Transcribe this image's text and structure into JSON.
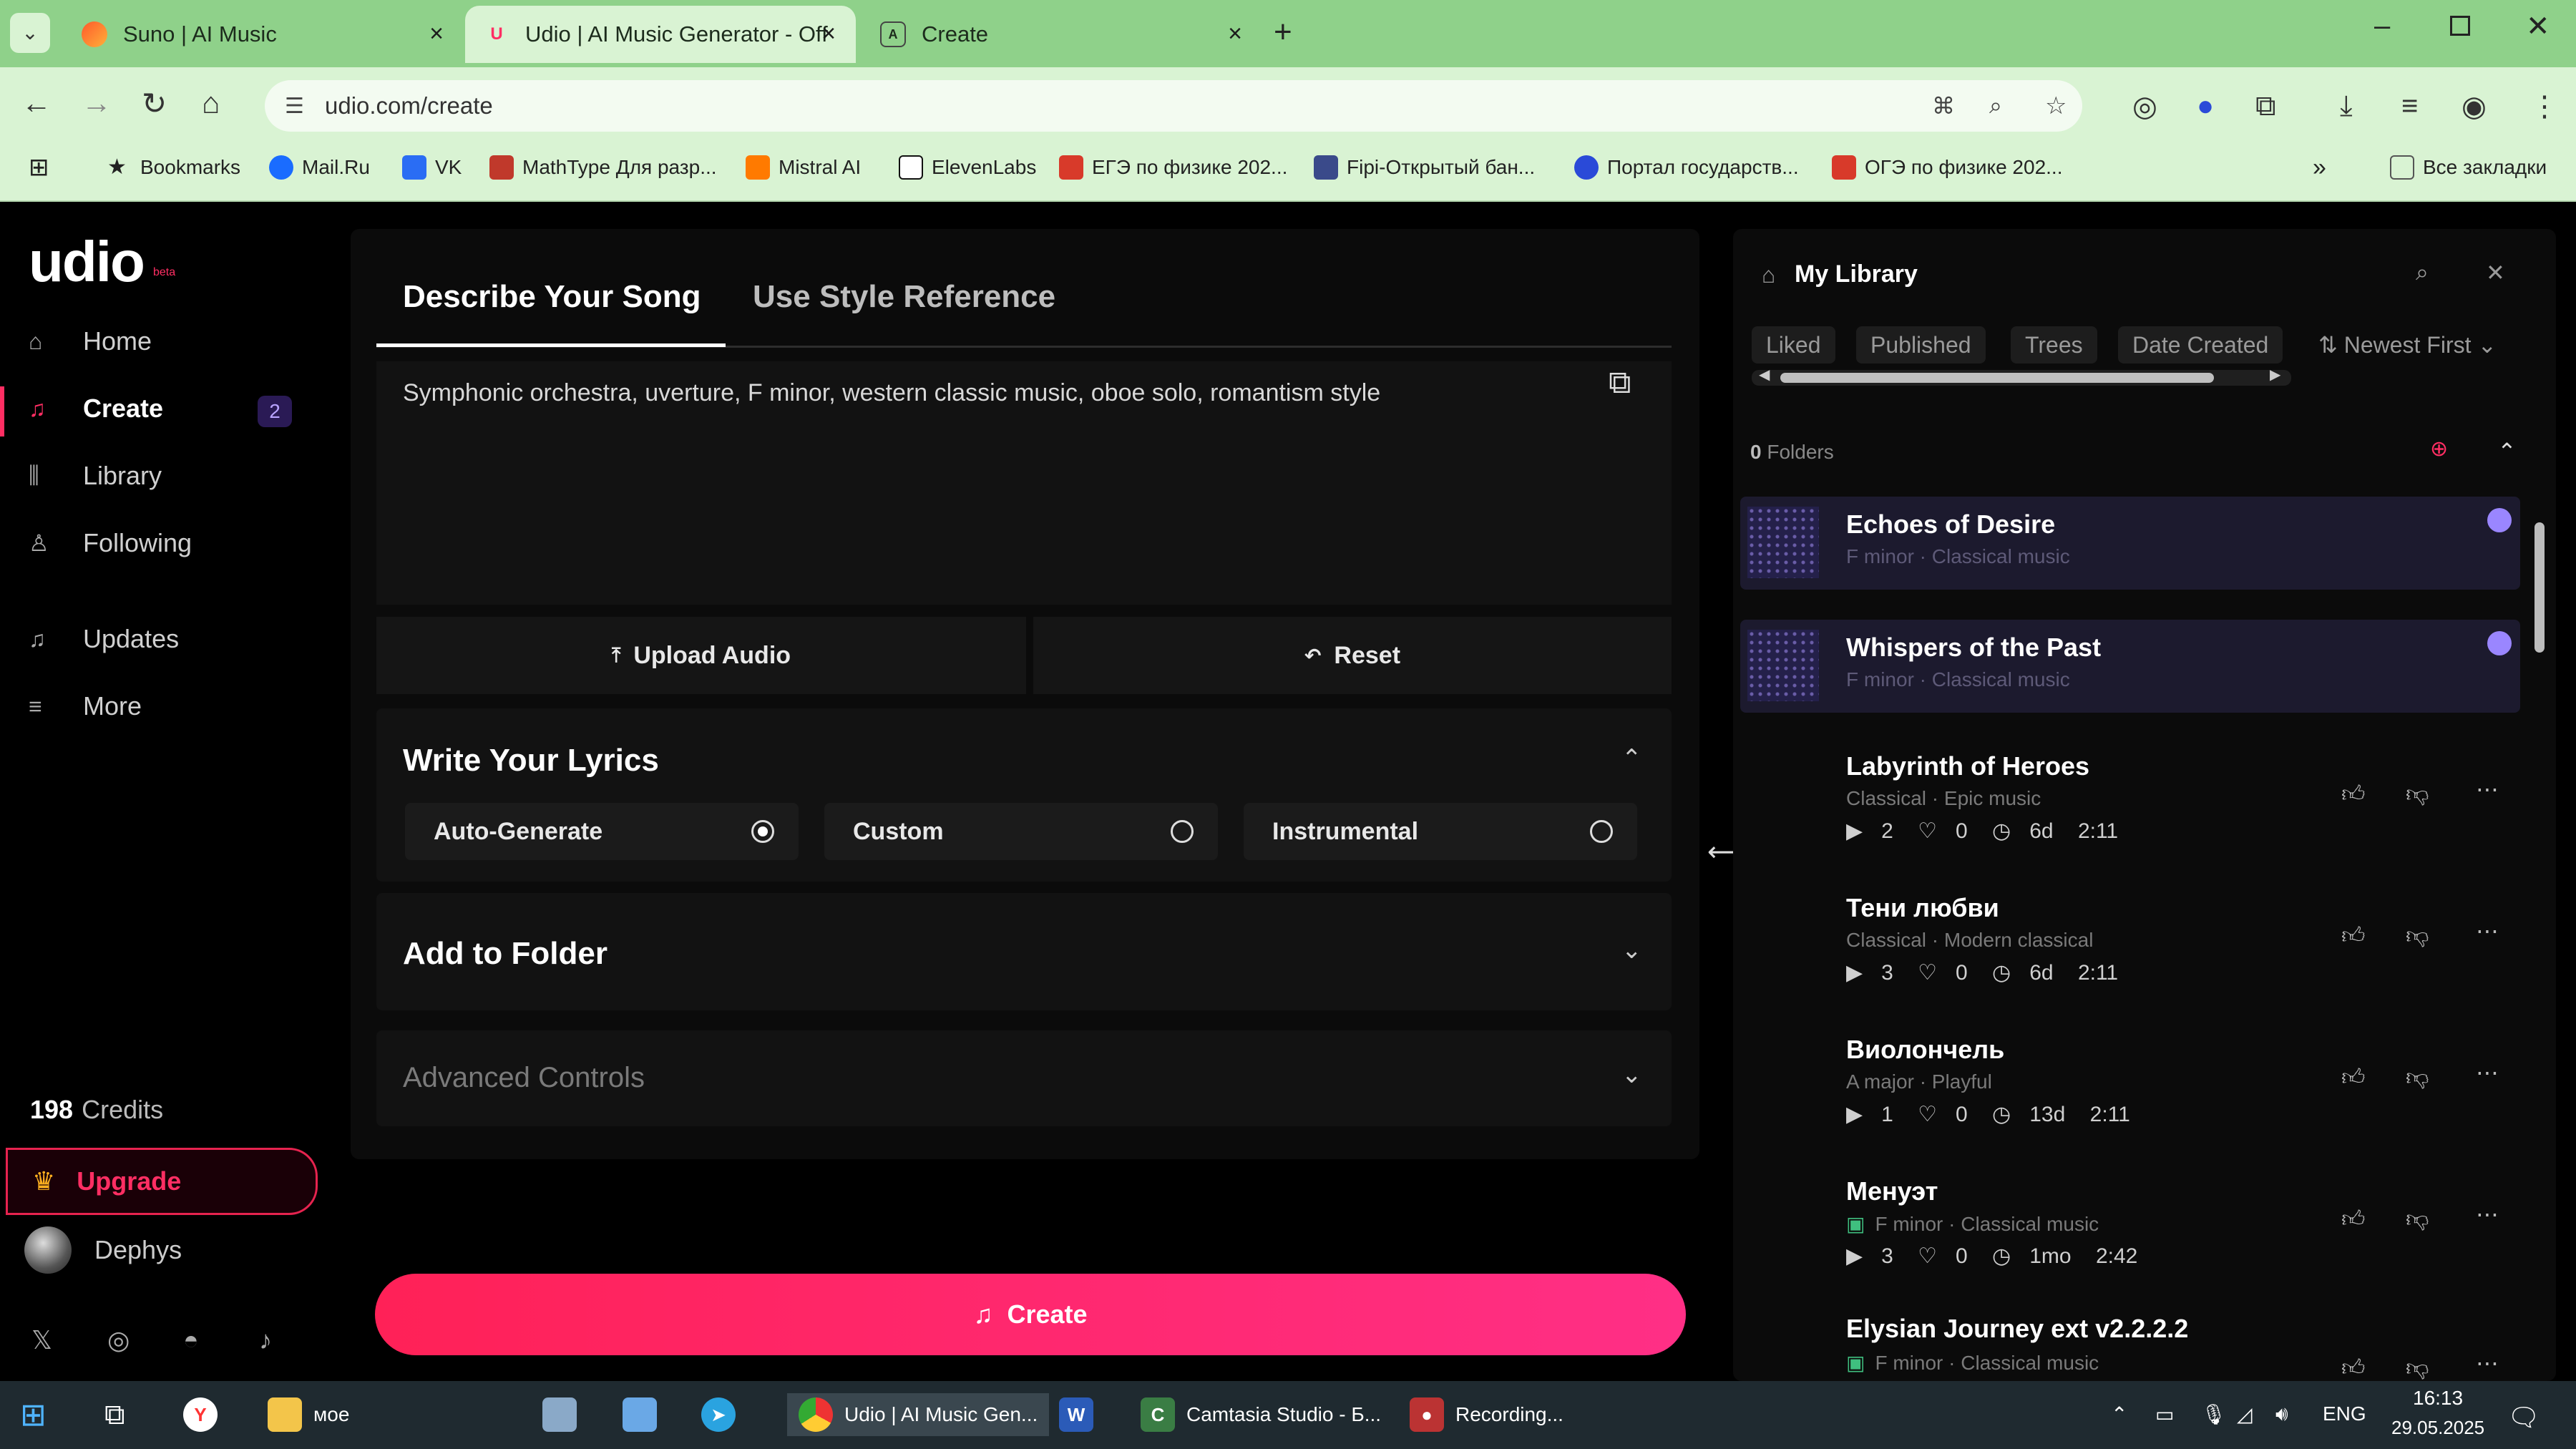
{
  "browser": {
    "tabs": [
      {
        "title": "Suno | AI Music",
        "icon": "suno-icon"
      },
      {
        "title": "Udio | AI Music Generator - Off",
        "icon": "udio-icon"
      },
      {
        "title": "Create",
        "icon": "page-icon"
      }
    ],
    "url": "udio.com/create",
    "bookmarks": [
      {
        "label": "Bookmarks",
        "color": "#222222"
      },
      {
        "label": "Mail.Ru",
        "color": "#1a6cff"
      },
      {
        "label": "VK",
        "color": "#2a6df4"
      },
      {
        "label": "MathType Для разр...",
        "color": "#c0392b"
      },
      {
        "label": "Mistral AI",
        "color": "#ff7a00"
      },
      {
        "label": "ElevenLabs",
        "color": "#111111"
      },
      {
        "label": "ЕГЭ по физике 202...",
        "color": "#d83a2a"
      },
      {
        "label": "Fipi-Открытый бан...",
        "color": "#3a4a8a"
      },
      {
        "label": "Портал государств...",
        "color": "#2a4ad8"
      },
      {
        "label": "ОГЭ по физике 202...",
        "color": "#d83a2a"
      }
    ],
    "all_bookmarks": "Все закладки"
  },
  "sidebar": {
    "logo": "udio",
    "nav": [
      {
        "label": "Home",
        "icon": "home-icon"
      },
      {
        "label": "Create",
        "icon": "music-note-icon"
      },
      {
        "label": "Library",
        "icon": "library-icon"
      },
      {
        "label": "Following",
        "icon": "user-icon"
      },
      {
        "label": "Updates",
        "icon": "bell-icon"
      },
      {
        "label": "More",
        "icon": "menu-icon"
      }
    ],
    "create_badge": "2",
    "credits_value": "198",
    "credits_label": "Credits",
    "upgrade": "Upgrade",
    "username": "Dephys"
  },
  "main": {
    "tabs": [
      "Describe Your Song",
      "Use Style Reference"
    ],
    "prompt": "Symphonic orchestra, uverture, F minor, western classic music, oboe solo, romantism style",
    "upload": "Upload Audio",
    "reset": "Reset",
    "lyrics_title": "Write Your Lyrics",
    "lyrics_options": [
      "Auto-Generate",
      "Custom",
      "Instrumental"
    ],
    "selected_lyrics": "Auto-Generate",
    "folder_title": "Add to Folder",
    "advanced_title": "Advanced Controls",
    "create_button": "Create"
  },
  "library": {
    "title": "My Library",
    "filters": [
      "Liked",
      "Published",
      "Trees",
      "Date Created",
      "Newest First"
    ],
    "folders_count": "0",
    "folders_label": "Folders",
    "songs": [
      {
        "title": "Echoes of Desire",
        "sub": "F minor  ·  Classical music",
        "highlight": true
      },
      {
        "title": "Whispers of the Past",
        "sub": "F minor  ·  Classical music",
        "highlight": true
      },
      {
        "title": "Labyrinth of Heroes",
        "sub": "Classical  ·  Epic music",
        "plays": "2",
        "likes": "0",
        "age": "6d",
        "duration": "2:11"
      },
      {
        "title": "Тени любви",
        "sub": "Classical  ·  Modern classical",
        "plays": "3",
        "likes": "0",
        "age": "6d",
        "duration": "2:11"
      },
      {
        "title": "Виолончель",
        "sub": "A major  ·  Playful",
        "plays": "1",
        "likes": "0",
        "age": "13d",
        "duration": "2:11"
      },
      {
        "title": "Менуэт",
        "sub": "F minor  ·  Classical music",
        "plays": "3",
        "likes": "0",
        "age": "1mo",
        "duration": "2:42"
      },
      {
        "title": "Elysian Journey ext v2.2.2.2",
        "sub": "F minor  ·  Classical music"
      }
    ]
  },
  "taskbar": {
    "items": [
      {
        "label": "",
        "icon": "windows-icon"
      },
      {
        "label": "",
        "icon": "task-view-icon"
      },
      {
        "label": "",
        "icon": "yandex-icon"
      },
      {
        "label": "мое",
        "icon": "folder-icon"
      },
      {
        "label": "",
        "icon": "app-icon"
      },
      {
        "label": "",
        "icon": "notepad-icon"
      },
      {
        "label": "",
        "icon": "telegram-icon"
      },
      {
        "label": "Udio | AI Music Gen...",
        "icon": "chrome-icon"
      },
      {
        "label": "",
        "icon": "word-icon"
      },
      {
        "label": "Camtasia Studio - Б...",
        "icon": "camtasia-icon"
      },
      {
        "label": "Recording...",
        "icon": "camtasia-rec-icon"
      }
    ],
    "lang": "ENG",
    "time": "16:13",
    "date": "29.05.2025"
  }
}
